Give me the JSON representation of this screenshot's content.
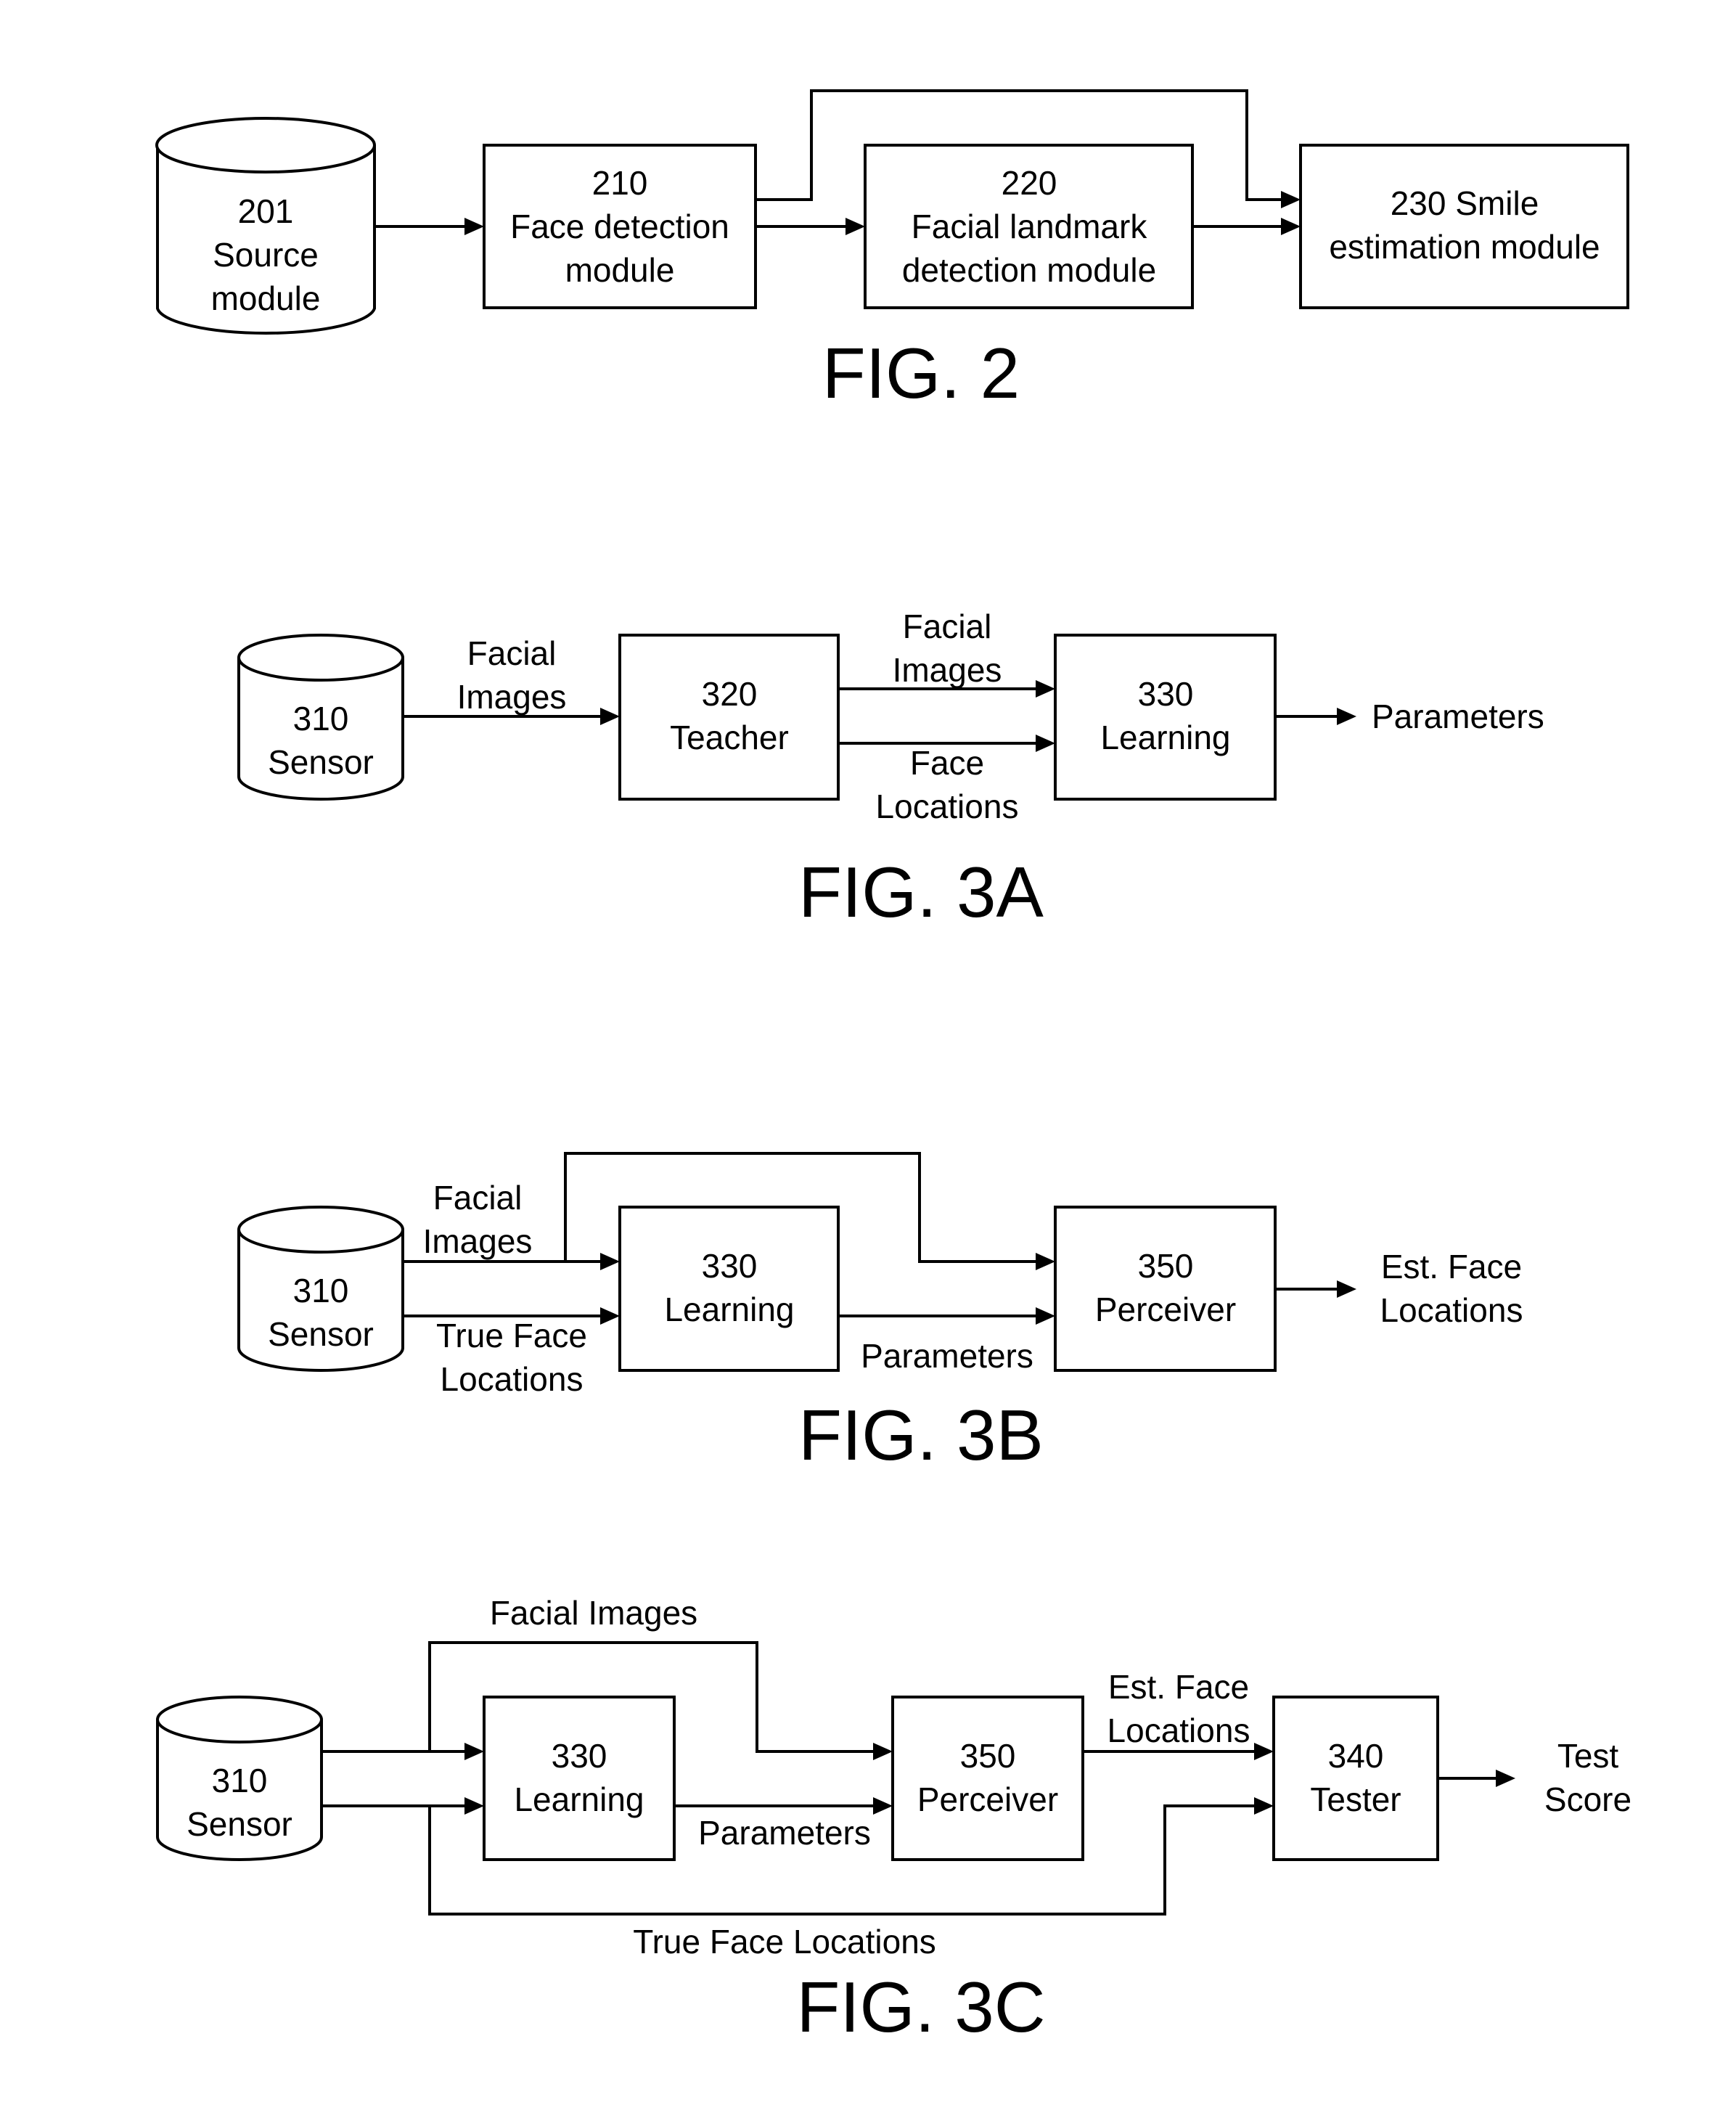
{
  "figures": {
    "fig2": {
      "caption": "FIG. 2",
      "source": {
        "lines": [
          "201",
          "Source",
          "module"
        ]
      },
      "face_detection": {
        "lines": [
          "210",
          "Face detection",
          "module"
        ]
      },
      "landmark": {
        "lines": [
          "220",
          "Facial landmark",
          "detection module"
        ]
      },
      "smile": {
        "lines": [
          "230 Smile",
          "estimation module"
        ]
      }
    },
    "fig3a": {
      "caption": "FIG. 3A",
      "sensor": {
        "lines": [
          "310",
          "Sensor"
        ]
      },
      "teacher": {
        "lines": [
          "320",
          "Teacher"
        ]
      },
      "learning": {
        "lines": [
          "330",
          "Learning"
        ]
      },
      "edge_facial_images_in": [
        "Facial",
        "Images"
      ],
      "edge_facial_images_mid": [
        "Facial",
        "Images"
      ],
      "edge_face_locations": [
        "Face",
        "Locations"
      ],
      "output": "Parameters"
    },
    "fig3b": {
      "caption": "FIG. 3B",
      "sensor": {
        "lines": [
          "310",
          "Sensor"
        ]
      },
      "learning": {
        "lines": [
          "330",
          "Learning"
        ]
      },
      "perceiver": {
        "lines": [
          "350",
          "Perceiver"
        ]
      },
      "edge_facial_images": [
        "Facial",
        "Images"
      ],
      "edge_true_face": [
        "True Face",
        "Locations"
      ],
      "edge_parameters": "Parameters",
      "output": [
        "Est. Face",
        "Locations"
      ]
    },
    "fig3c": {
      "caption": "FIG. 3C",
      "sensor": {
        "lines": [
          "310",
          "Sensor"
        ]
      },
      "learning": {
        "lines": [
          "330",
          "Learning"
        ]
      },
      "perceiver": {
        "lines": [
          "350",
          "Perceiver"
        ]
      },
      "tester": {
        "lines": [
          "340",
          "Tester"
        ]
      },
      "edge_facial_images": "Facial Images",
      "edge_parameters": "Parameters",
      "edge_est_face": [
        "Est. Face",
        "Locations"
      ],
      "edge_true_face": "True Face Locations",
      "output": [
        "Test",
        "Score"
      ]
    }
  }
}
